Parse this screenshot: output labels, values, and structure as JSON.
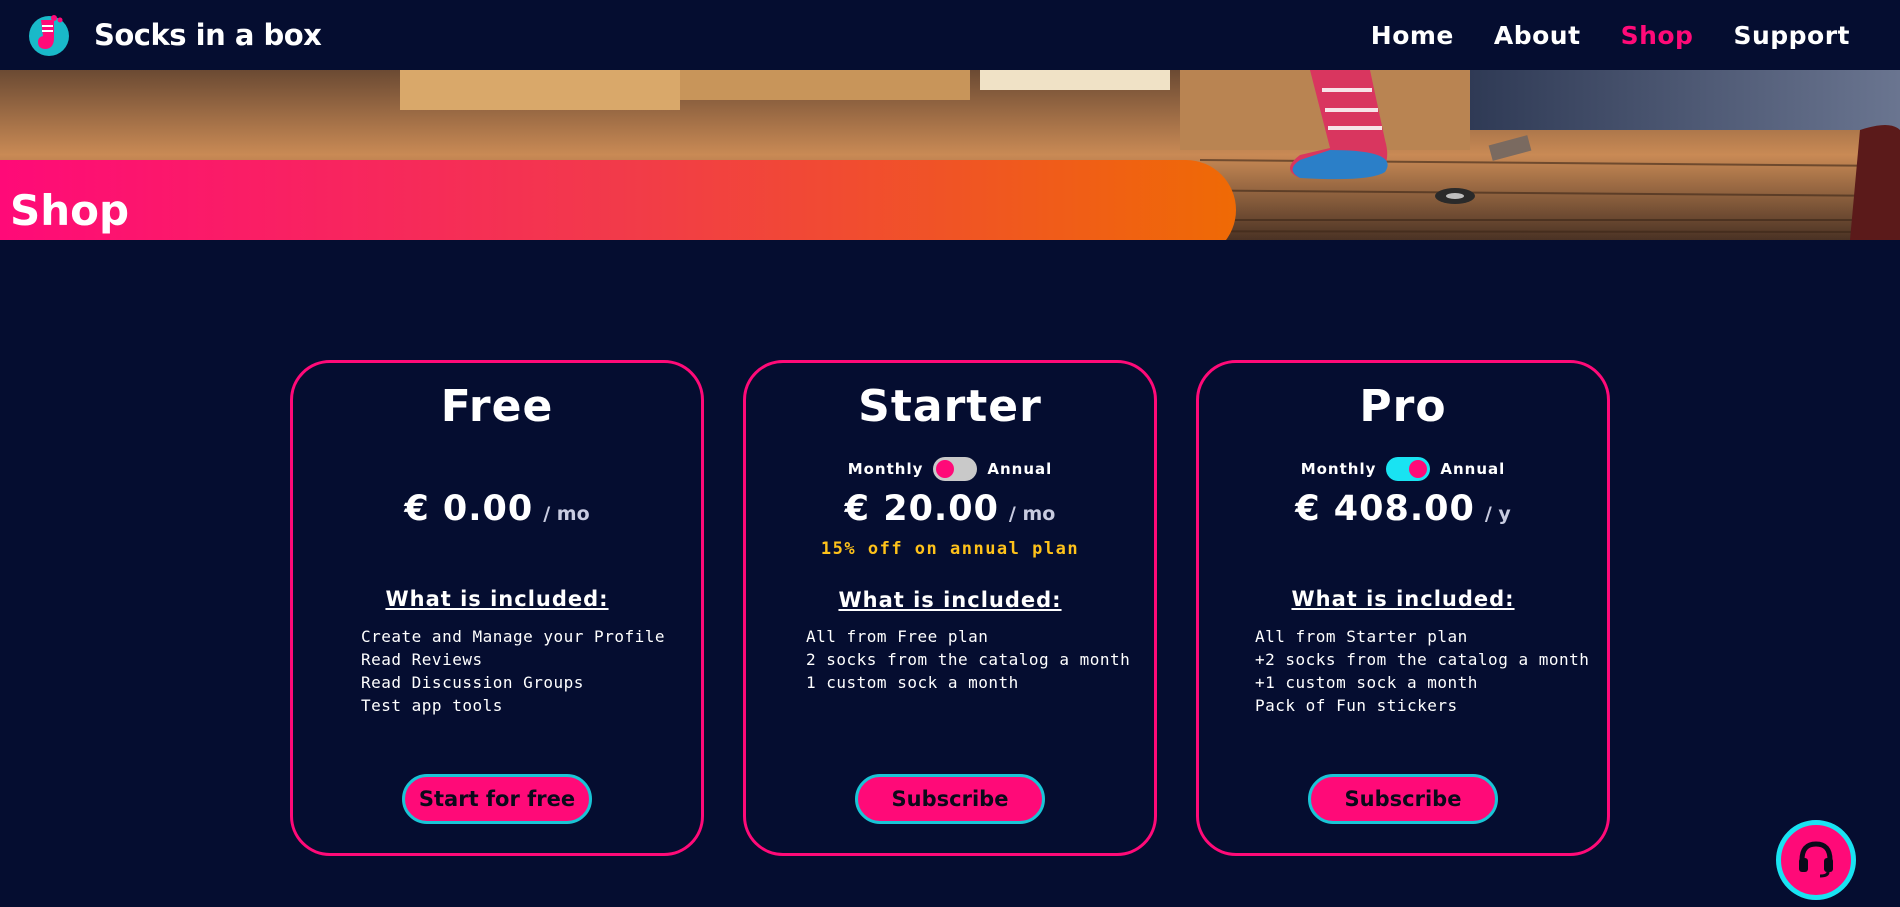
{
  "app": {
    "name": "Socks in a box"
  },
  "nav": {
    "items": [
      {
        "label": "Home",
        "active": false
      },
      {
        "label": "About",
        "active": false
      },
      {
        "label": "Shop",
        "active": true
      },
      {
        "label": "Support",
        "active": false
      }
    ]
  },
  "hero": {
    "title": "Shop"
  },
  "plans": [
    {
      "name": "Free",
      "has_toggle": false,
      "price": "€ 0.00",
      "period": "/ mo",
      "discount": "",
      "included_heading": "What is included:",
      "features": [
        "Create and Manage your Profile",
        "Read Reviews",
        "Read Discussion Groups",
        "Test app tools"
      ],
      "cta": "Start for free"
    },
    {
      "name": "Starter",
      "has_toggle": true,
      "toggle_left": "Monthly",
      "toggle_right": "Annual",
      "toggle_state": "monthly",
      "price": "€ 20.00",
      "period": "/ mo",
      "discount": "15% off on annual plan",
      "included_heading": "What is included:",
      "features": [
        "All from Free plan",
        "2 socks from the catalog a month",
        "1 custom sock a month"
      ],
      "cta": "Subscribe"
    },
    {
      "name": "Pro",
      "has_toggle": true,
      "toggle_left": "Monthly",
      "toggle_right": "Annual",
      "toggle_state": "annual",
      "price": "€ 408.00",
      "period": "/ y",
      "discount": "",
      "included_heading": "What is included:",
      "features": [
        "All from Starter plan",
        "+2 socks from the catalog a month",
        "+1 custom sock a month",
        "Pack of Fun stickers"
      ],
      "cta": "Subscribe"
    }
  ],
  "support": {
    "icon": "headset-icon"
  },
  "colors": {
    "background": "#050d30",
    "accent_pink": "#ff0a78",
    "accent_cyan": "#19e3f2",
    "discount_yellow": "#ffc21a",
    "banner_orange": "#ef6a05"
  }
}
